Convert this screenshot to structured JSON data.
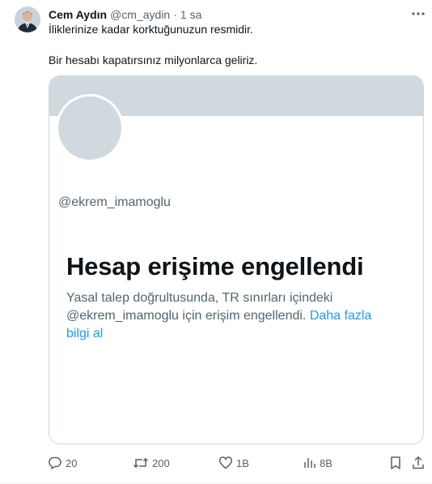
{
  "tweet": {
    "author_name": "Cem Aydın",
    "handle": "@cm_aydin",
    "separator": "·",
    "time": "1 sa",
    "text_line_1": "İliklerinize kadar korktuğunuzun resmidir.",
    "text_line_2": "Bir hesabı kapatırsınız milyonlarca geliriz."
  },
  "card": {
    "handle": "@ekrem_imamoglu",
    "title": "Hesap erişime engellendi",
    "description_line_1": "Yasal talep doğrultusunda, TR sınırları içindeki",
    "description_line_2": "@ekrem_imamoglu için erişim engellendi.",
    "link_part_1": "Daha fazla",
    "link_part_2": "bilgi al"
  },
  "actions": {
    "replies": "20",
    "reposts": "200",
    "likes": "1B",
    "views": "8B"
  },
  "colors": {
    "text_primary": "#0f1419",
    "text_secondary": "#536471",
    "link": "#1d9bf0",
    "border": "#cfd9de"
  },
  "icons": {
    "more": "more-dots-icon",
    "reply": "reply-icon",
    "repost": "repost-icon",
    "like": "heart-icon",
    "views": "views-icon",
    "bookmark": "bookmark-icon",
    "share": "share-icon"
  }
}
